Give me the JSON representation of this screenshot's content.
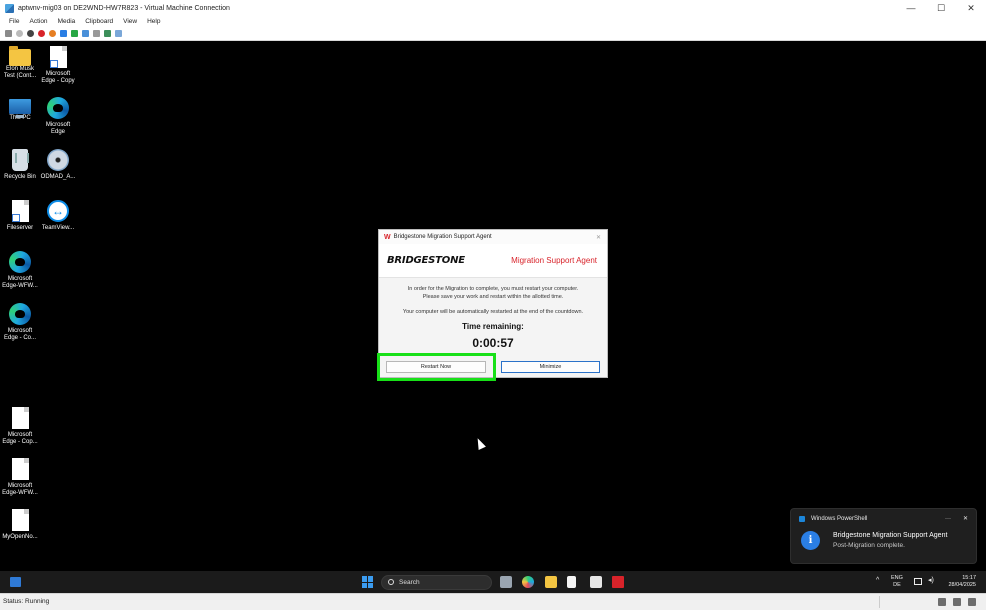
{
  "window": {
    "title": "aptwnv-mig03 on DE2WND-HW7R823 - Virtual Machine Connection",
    "controls": [
      "minimize",
      "maximize",
      "close"
    ]
  },
  "menu": [
    "File",
    "Action",
    "Media",
    "Clipboard",
    "View",
    "Help"
  ],
  "desktop_icons": [
    {
      "label": "Elon Musk Test (Cont...",
      "icon": "folder-icon"
    },
    {
      "label": "Microsoft Edge - Copy",
      "icon": "file-shortcut-icon"
    },
    {
      "label": "This PC",
      "icon": "this-pc-icon"
    },
    {
      "label": "Microsoft Edge",
      "icon": "edge-icon"
    },
    {
      "label": "Recycle Bin",
      "icon": "recycle-bin-icon"
    },
    {
      "label": "ODMAD_A...",
      "icon": "cd-icon"
    },
    {
      "label": "Fileserver",
      "icon": "file-shortcut-icon"
    },
    {
      "label": "TeamView...",
      "icon": "teamviewer-icon"
    },
    {
      "label": "Microsoft Edge-WFW...",
      "icon": "edge-icon"
    },
    {
      "label": "Microsoft Edge - Co...",
      "icon": "edge-icon"
    },
    {
      "label": "Microsoft Edge - Cop...",
      "icon": "file-icon"
    },
    {
      "label": "Microsoft Edge-WFW...",
      "icon": "file-icon"
    },
    {
      "label": "MyOpenNo...",
      "icon": "file-icon"
    }
  ],
  "dialog": {
    "title": "Bridgestone Migration Support Agent",
    "brand": "BRIDGESTONE",
    "header_title": "Migration Support Agent",
    "message": "In order for the Migration to complete, you must restart your computer.\nPlease save your work and restart within the allotted time.",
    "auto_restart_note": "Your computer will be automatically restarted at the end of the countdown.",
    "time_label": "Time remaining:",
    "countdown": "0:00:57",
    "restart_button": "Restart Now",
    "minimize_button": "Minimize",
    "accent_color": "#d8232a"
  },
  "toast": {
    "app": "Windows PowerShell",
    "title": "Bridgestone Migration Support Agent",
    "message": "Post-Migration complete."
  },
  "taskbar": {
    "search_placeholder": "Search",
    "lang": "ENG",
    "region": "DE",
    "time": "15:17",
    "date": "28/04/2025"
  },
  "status": {
    "text": "Status: Running"
  }
}
